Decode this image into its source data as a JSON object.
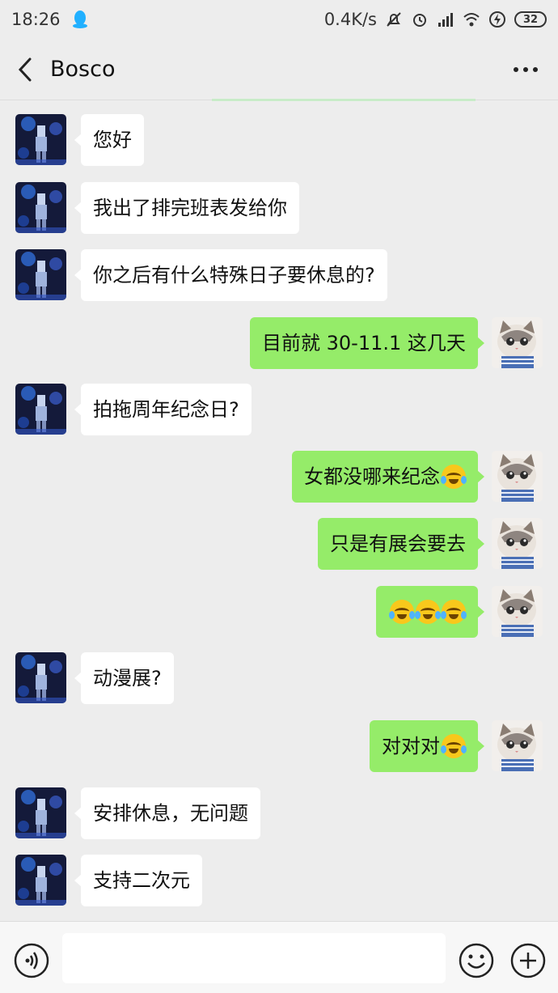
{
  "status_bar": {
    "time": "18:26",
    "network_speed": "0.4K/s",
    "battery": "32",
    "icons": [
      "qq-icon",
      "mute-icon",
      "alarm-icon",
      "signal-icon",
      "wifi-icon",
      "charging-icon",
      "battery-icon"
    ]
  },
  "header": {
    "title": "Bosco",
    "back_icon": "chevron-left-icon",
    "more_icon": "more-icon"
  },
  "messages": [
    {
      "side": "left",
      "text": "您好"
    },
    {
      "side": "left",
      "text": "我出了排完班表发给你"
    },
    {
      "side": "left",
      "text": "你之后有什么特殊日子要休息的?"
    },
    {
      "side": "right",
      "text": "目前就 30-11.1 这几天"
    },
    {
      "side": "left",
      "text": "拍拖周年纪念日?"
    },
    {
      "side": "right",
      "text": "女都没哪来纪念",
      "emoji": "cry-laugh-emoji"
    },
    {
      "side": "right",
      "text": "只是有展会要去"
    },
    {
      "side": "right",
      "text": "",
      "emoji_count": 3,
      "emoji": "cry-laugh-emoji"
    },
    {
      "side": "left",
      "text": "动漫展?"
    },
    {
      "side": "right",
      "text": "对对对",
      "emoji": "cry-laugh-emoji"
    },
    {
      "side": "left",
      "text": "安排休息，无问题"
    },
    {
      "side": "left",
      "text": "支持二次元"
    }
  ],
  "input_bar": {
    "placeholder": "",
    "icons": [
      "voice-icon",
      "emoji-icon",
      "plus-icon"
    ]
  },
  "colors": {
    "background": "#ededed",
    "sent_bubble": "#95ec69",
    "received_bubble": "#ffffff"
  }
}
